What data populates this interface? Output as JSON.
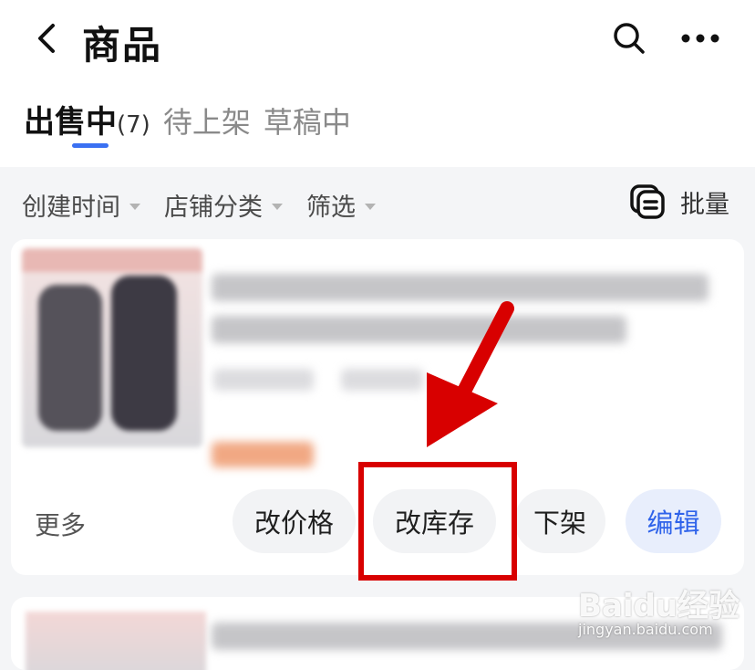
{
  "header": {
    "title": "商品",
    "tabs": [
      {
        "label": "出售中",
        "count": "(7)"
      },
      {
        "label": "待上架"
      },
      {
        "label": "草稿中"
      }
    ]
  },
  "filters": {
    "items": [
      "创建时间",
      "店铺分类",
      "筛选"
    ],
    "batch_label": "批量"
  },
  "product_card": {
    "more_label": "更多",
    "actions": [
      "改价格",
      "改库存",
      "下架",
      "编辑"
    ]
  },
  "watermark": {
    "logo": "Baidu经验",
    "sub": "jingyan.baidu.com"
  },
  "colors": {
    "accent": "#3a70f2",
    "annotation": "#d80000",
    "edit_button_bg": "#e8eefc",
    "edit_button_text": "#2f63ea"
  }
}
